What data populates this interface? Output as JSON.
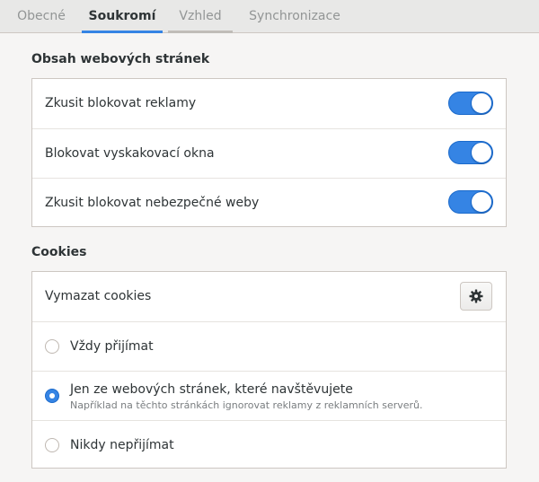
{
  "tabs": [
    {
      "label": "Obecné",
      "state": "inactive"
    },
    {
      "label": "Soukromí",
      "state": "active"
    },
    {
      "label": "Vzhled",
      "state": "hover"
    },
    {
      "label": "Synchronizace",
      "state": "inactive"
    }
  ],
  "content_section": {
    "heading": "Obsah webových stránek",
    "items": [
      {
        "label": "Zkusit blokovat reklamy",
        "enabled": true
      },
      {
        "label": "Blokovat vyskakovací okna",
        "enabled": true
      },
      {
        "label": "Zkusit blokovat nebezpečné weby",
        "enabled": true
      }
    ]
  },
  "cookies_section": {
    "heading": "Cookies",
    "clear_label": "Vymazat cookies",
    "clear_icon": "gear-icon",
    "options": [
      {
        "label": "Vždy přijímat",
        "subtitle": "",
        "selected": false
      },
      {
        "label": "Jen ze webových stránek, které navštěvujete",
        "subtitle": "Například na těchto stránkách ignorovat reklamy z reklamních serverů.",
        "selected": true
      },
      {
        "label": "Nikdy nepřijímat",
        "subtitle": "",
        "selected": false
      }
    ]
  },
  "colors": {
    "accent": "#3584e4",
    "background": "#f6f5f4",
    "frame": "#ffffff",
    "text": "#2e3436",
    "inactive_tab_text": "#929595"
  }
}
